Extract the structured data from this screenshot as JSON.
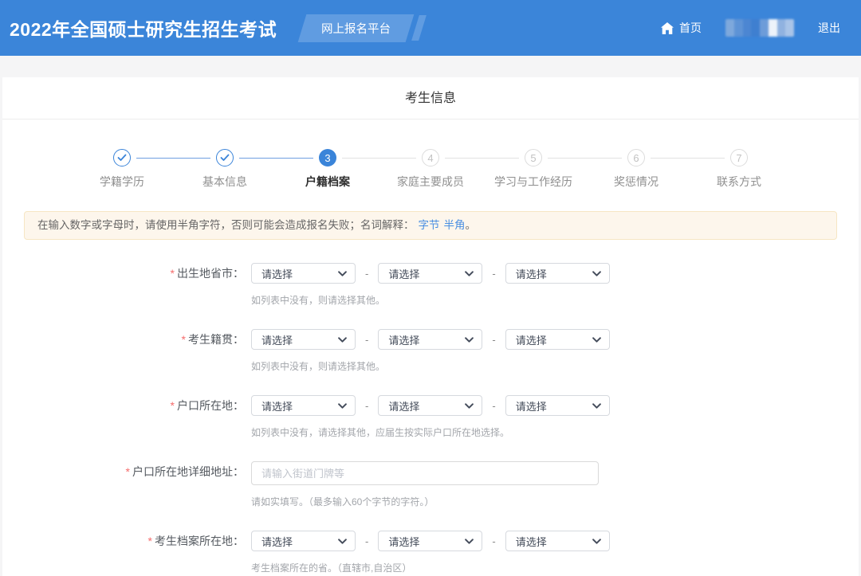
{
  "header": {
    "title": "2022年全国硕士研究生招生考试",
    "badge": "网上报名平台",
    "nav": {
      "home": "首页",
      "logout": "退出"
    }
  },
  "page": {
    "section_title": "考生信息"
  },
  "stepper": {
    "steps": [
      {
        "label": "学籍学历",
        "state": "done",
        "icon": "check-icon"
      },
      {
        "label": "基本信息",
        "state": "done",
        "icon": "check-icon"
      },
      {
        "label": "户籍档案",
        "state": "active",
        "number": "3"
      },
      {
        "label": "家庭主要成员",
        "state": "todo",
        "number": "4"
      },
      {
        "label": "学习与工作经历",
        "state": "todo",
        "number": "5"
      },
      {
        "label": "奖惩情况",
        "state": "todo",
        "number": "6"
      },
      {
        "label": "联系方式",
        "state": "todo",
        "number": "7"
      }
    ]
  },
  "notice": {
    "text": "在输入数字或字母时，请使用半角字符，否则可能会造成报名失败；名词解释：",
    "link_byte": "字节",
    "link_halfwidth": "半角",
    "suffix": "。"
  },
  "form": {
    "required_mark": "*",
    "select_placeholder": "请选择",
    "separator": "-",
    "rows": [
      {
        "label": "出生地省市：",
        "hint": "如列表中没有，则请选择其他。"
      },
      {
        "label": "考生籍贯：",
        "hint": "如列表中没有，则请选择其他。"
      },
      {
        "label": "户口所在地：",
        "hint": "如列表中没有，请选择其他，应届生按实际户口所在地选择。"
      },
      {
        "label": "户口所在地详细地址：",
        "placeholder": "请输入街道门牌等",
        "hint": "请如实填写。（最多输入60个字节的字符。）"
      },
      {
        "label": "考生档案所在地：",
        "hint": "考生档案所在的省。（直辖市,自治区）"
      }
    ]
  },
  "colors": {
    "header_blue": "#3b85d9",
    "accent_blue": "#3a84d9",
    "link_blue": "#4a8fe2",
    "notice_bg": "#fdf6ec",
    "required_red": "#f56c6c"
  }
}
